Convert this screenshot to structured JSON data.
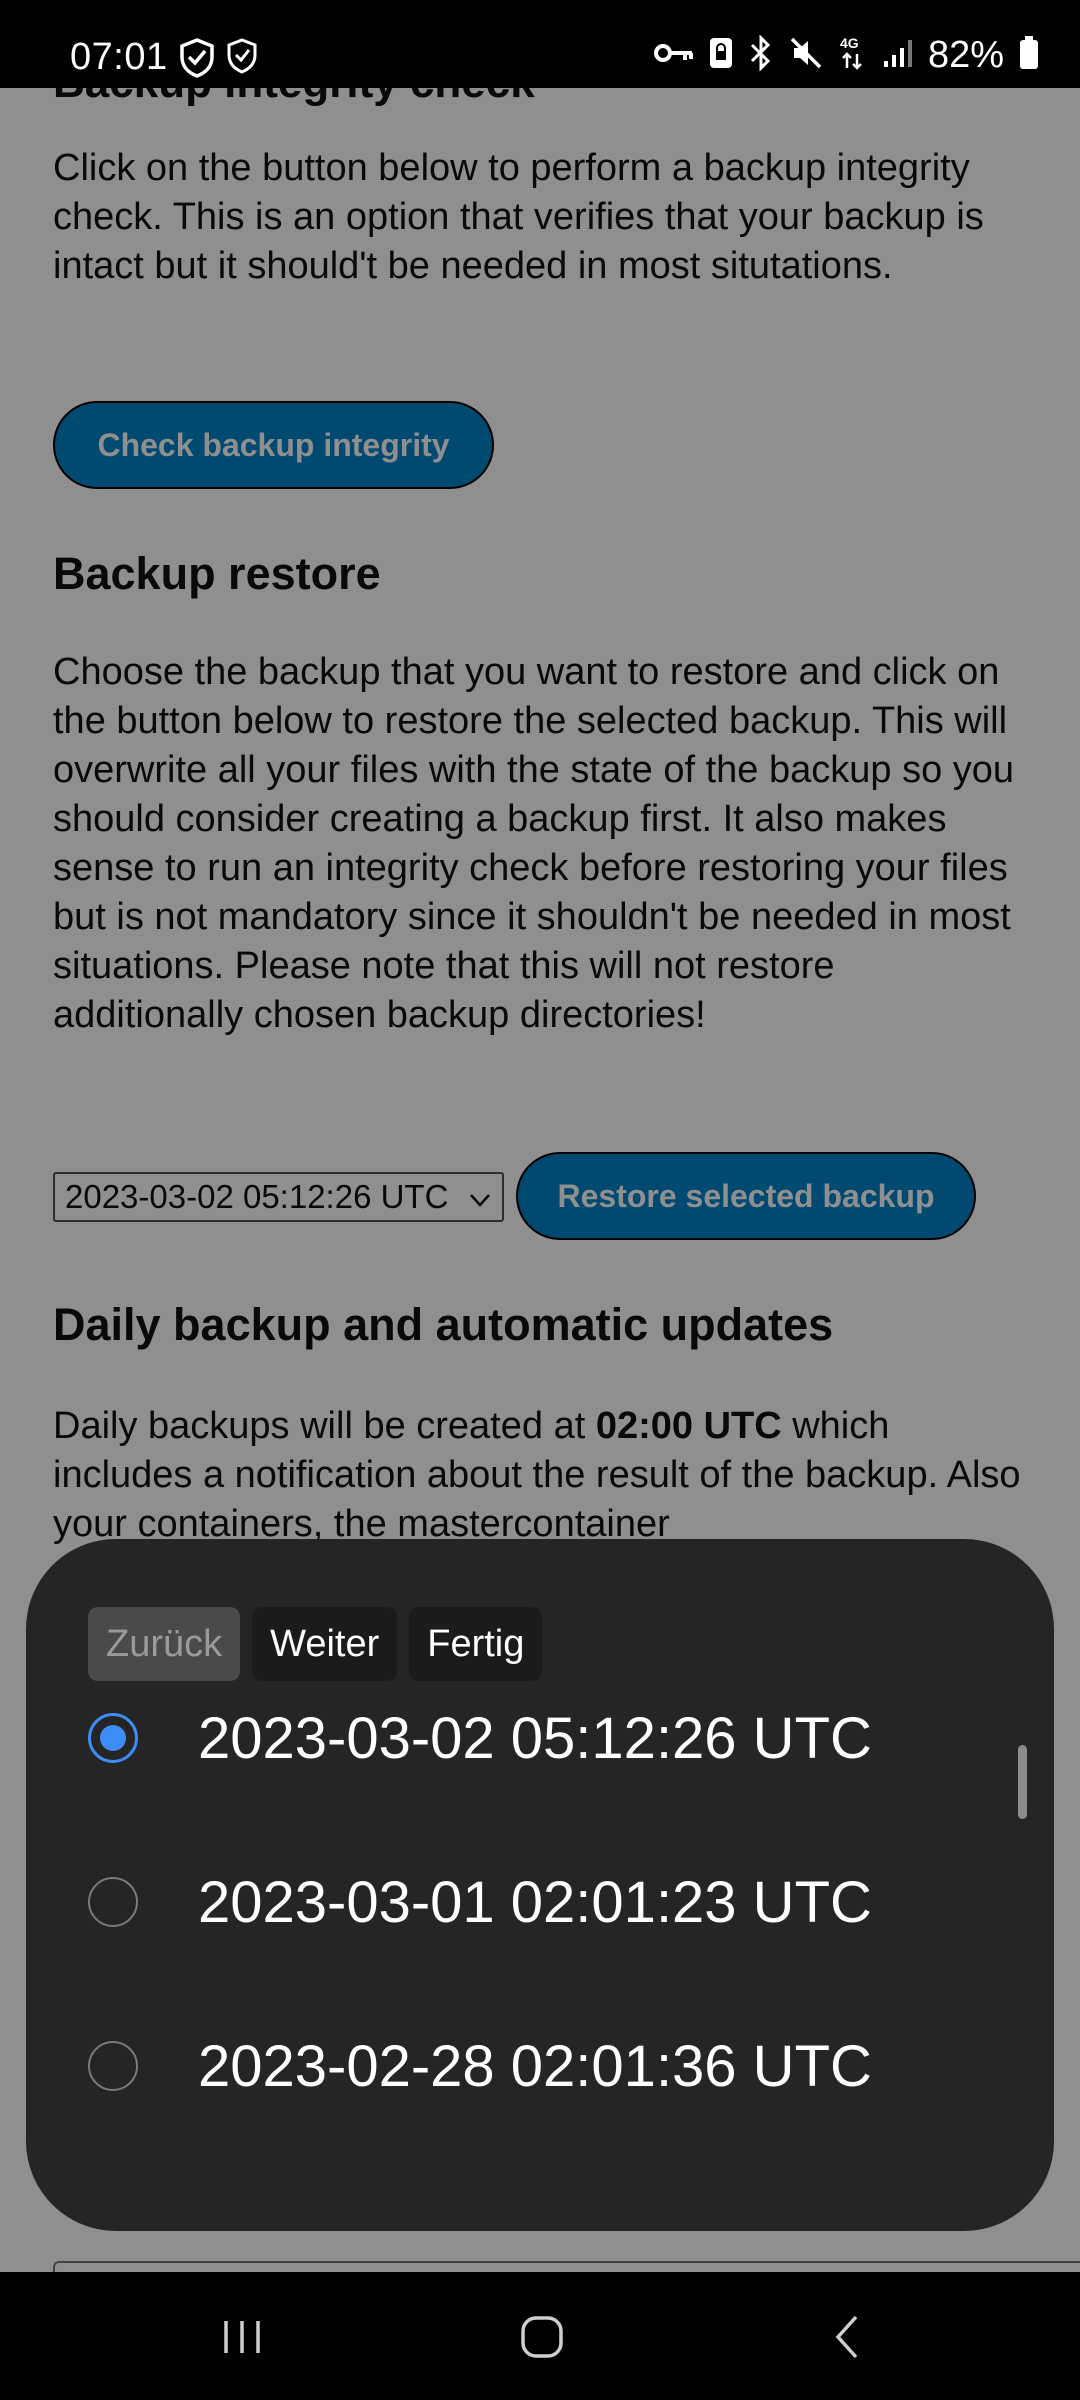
{
  "status_bar": {
    "time": "07:01",
    "battery": "82%",
    "network": "4G"
  },
  "page": {
    "clipped_heading": "Backup integrity check",
    "integrity_text": "Click on the button below to perform a backup integrity check. This is an option that verifies that your backup is intact but it should't be needed in most situtations.",
    "integrity_button": "Check backup integrity",
    "restore_heading": "Backup restore",
    "restore_text": "Choose the backup that you want to restore and click on the button below to restore the selected backup. This will overwrite all your files with the state of the backup so you should consider creating a backup first. It also makes sense to run an integrity check before restoring your files but is not mandatory since it shouldn't be needed in most situations. Please note that this will not restore additionally chosen backup directories!",
    "selected_backup": "2023-03-02 05:12:26 UTC",
    "restore_button": "Restore selected backup",
    "daily_heading": "Daily backup and automatic updates",
    "daily_text_pre": "Daily backups will be created at ",
    "daily_text_bold": "02:00 UTC",
    "daily_text_post": " which includes a notification about the result of the backup. Also your containers, the mastercontainer"
  },
  "picker": {
    "back_label": "Zurück",
    "next_label": "Weiter",
    "done_label": "Fertig",
    "options": [
      {
        "label": "2023-03-02 05:12:26 UTC",
        "selected": true
      },
      {
        "label": "2023-03-01 02:01:23 UTC",
        "selected": false
      },
      {
        "label": "2023-02-28 02:01:36 UTC",
        "selected": false
      }
    ]
  },
  "colors": {
    "accent_button": "#0082c9",
    "radio_selected": "#3e8cf5",
    "sheet_background": "#252525"
  }
}
